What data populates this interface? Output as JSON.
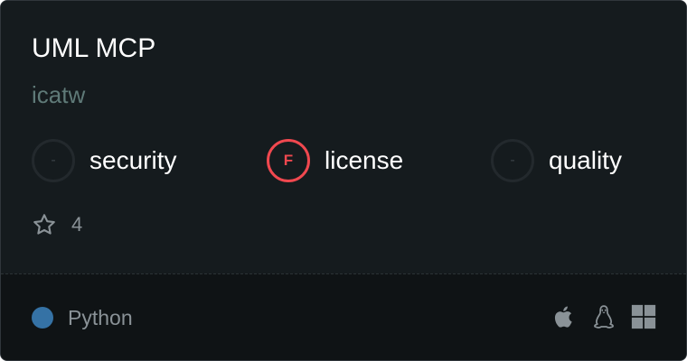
{
  "server": {
    "name": "UML MCP",
    "author": "icatw"
  },
  "badges": [
    {
      "grade": "-",
      "label": "security"
    },
    {
      "grade": "F",
      "label": "license"
    },
    {
      "grade": "-",
      "label": "quality"
    }
  ],
  "stars": {
    "count": "4",
    "icon": "star-outline-icon"
  },
  "language": {
    "name": "Python",
    "color": "#3572a5"
  },
  "platforms": [
    "apple-icon",
    "linux-icon",
    "windows-icon"
  ],
  "colors": {
    "grade_f": "#f0484f",
    "muted_text": "#8a9297",
    "author_text": "#5f7a78"
  }
}
